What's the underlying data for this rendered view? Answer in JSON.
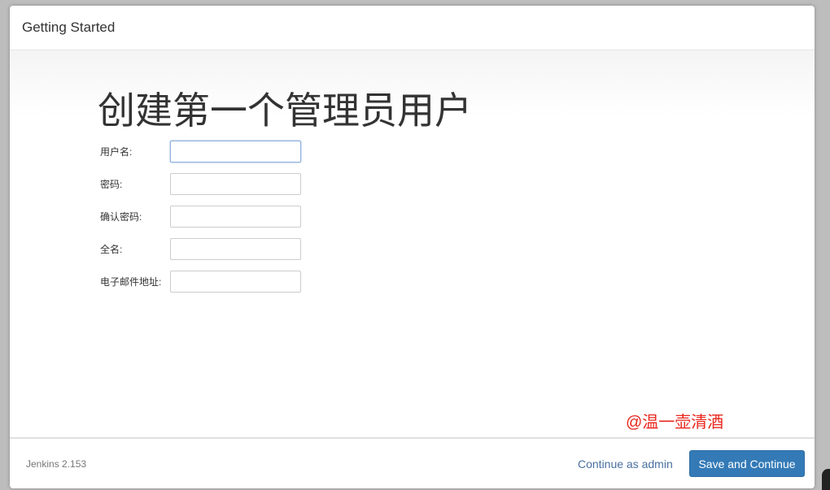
{
  "header": {
    "title": "Getting Started"
  },
  "main": {
    "heading": "创建第一个管理员用户",
    "fields": [
      {
        "label": "用户名:",
        "value": ""
      },
      {
        "label": "密码:",
        "value": ""
      },
      {
        "label": "确认密码:",
        "value": ""
      },
      {
        "label": "全名:",
        "value": ""
      },
      {
        "label": "电子邮件地址:",
        "value": ""
      }
    ],
    "watermark": "@温一壶清酒"
  },
  "footer": {
    "version": "Jenkins 2.153",
    "continue_admin": "Continue as admin",
    "save_continue": "Save and Continue"
  },
  "colors": {
    "primary": "#337ab7",
    "watermark": "#e8261c"
  }
}
